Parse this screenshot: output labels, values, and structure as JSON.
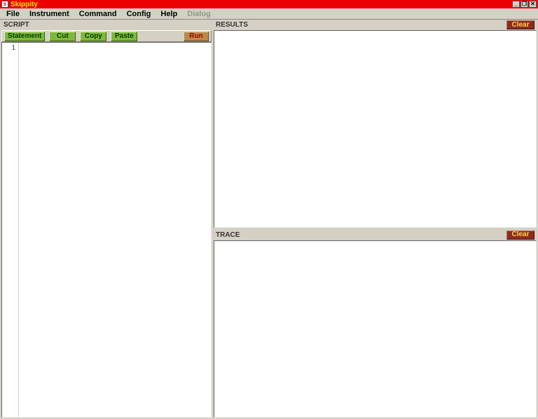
{
  "window": {
    "title": "Skippity",
    "buttons": {
      "min": "_",
      "max": "❐",
      "close": "✕"
    }
  },
  "menubar": {
    "items": [
      {
        "label": "File",
        "enabled": true
      },
      {
        "label": "Instrument",
        "enabled": true
      },
      {
        "label": "Command",
        "enabled": true
      },
      {
        "label": "Config",
        "enabled": true
      },
      {
        "label": "Help",
        "enabled": true
      },
      {
        "label": "Dialog",
        "enabled": false
      }
    ]
  },
  "panels": {
    "script": {
      "title": "SCRIPT"
    },
    "results": {
      "title": "RESULTS",
      "clear_label": "Clear"
    },
    "trace": {
      "title": "TRACE",
      "clear_label": "Clear"
    }
  },
  "toolbar": {
    "statement": "Statement",
    "cut": "Cut",
    "copy": "Copy",
    "paste": "Paste",
    "run": "Run"
  },
  "editor": {
    "line_numbers": [
      "1"
    ],
    "content": ""
  }
}
